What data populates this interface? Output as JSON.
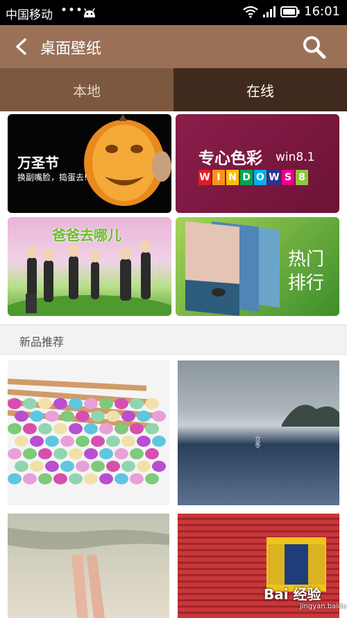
{
  "status": {
    "carrier": "中国移动",
    "dots": "•••",
    "time": "16:01"
  },
  "header": {
    "title": "桌面壁纸"
  },
  "tabs": [
    {
      "label": "本地"
    },
    {
      "label": "在线"
    }
  ],
  "banners": {
    "halloween": {
      "title": "万圣节",
      "subtitle": "换副嘴脸，捣蛋去!"
    },
    "colors": {
      "title": "专心色彩",
      "version": "win8.1",
      "letters": [
        "W",
        "I",
        "N",
        "D",
        "O",
        "W",
        "S",
        "8"
      ],
      "letter_colors": [
        "#e31b23",
        "#f7941d",
        "#fcc100",
        "#00a651",
        "#00aeef",
        "#2e3192",
        "#ec008c",
        "#8dc63f"
      ]
    },
    "dad": {
      "text": "爸爸去哪儿"
    },
    "hot": {
      "line1": "热门",
      "line2": "排行"
    }
  },
  "section": {
    "title": "新品推荐"
  },
  "thumbnails": {
    "winter_text": "立冬"
  },
  "watermark": {
    "brand": "Bai 经验",
    "url": "jingyan.baidu.com"
  }
}
